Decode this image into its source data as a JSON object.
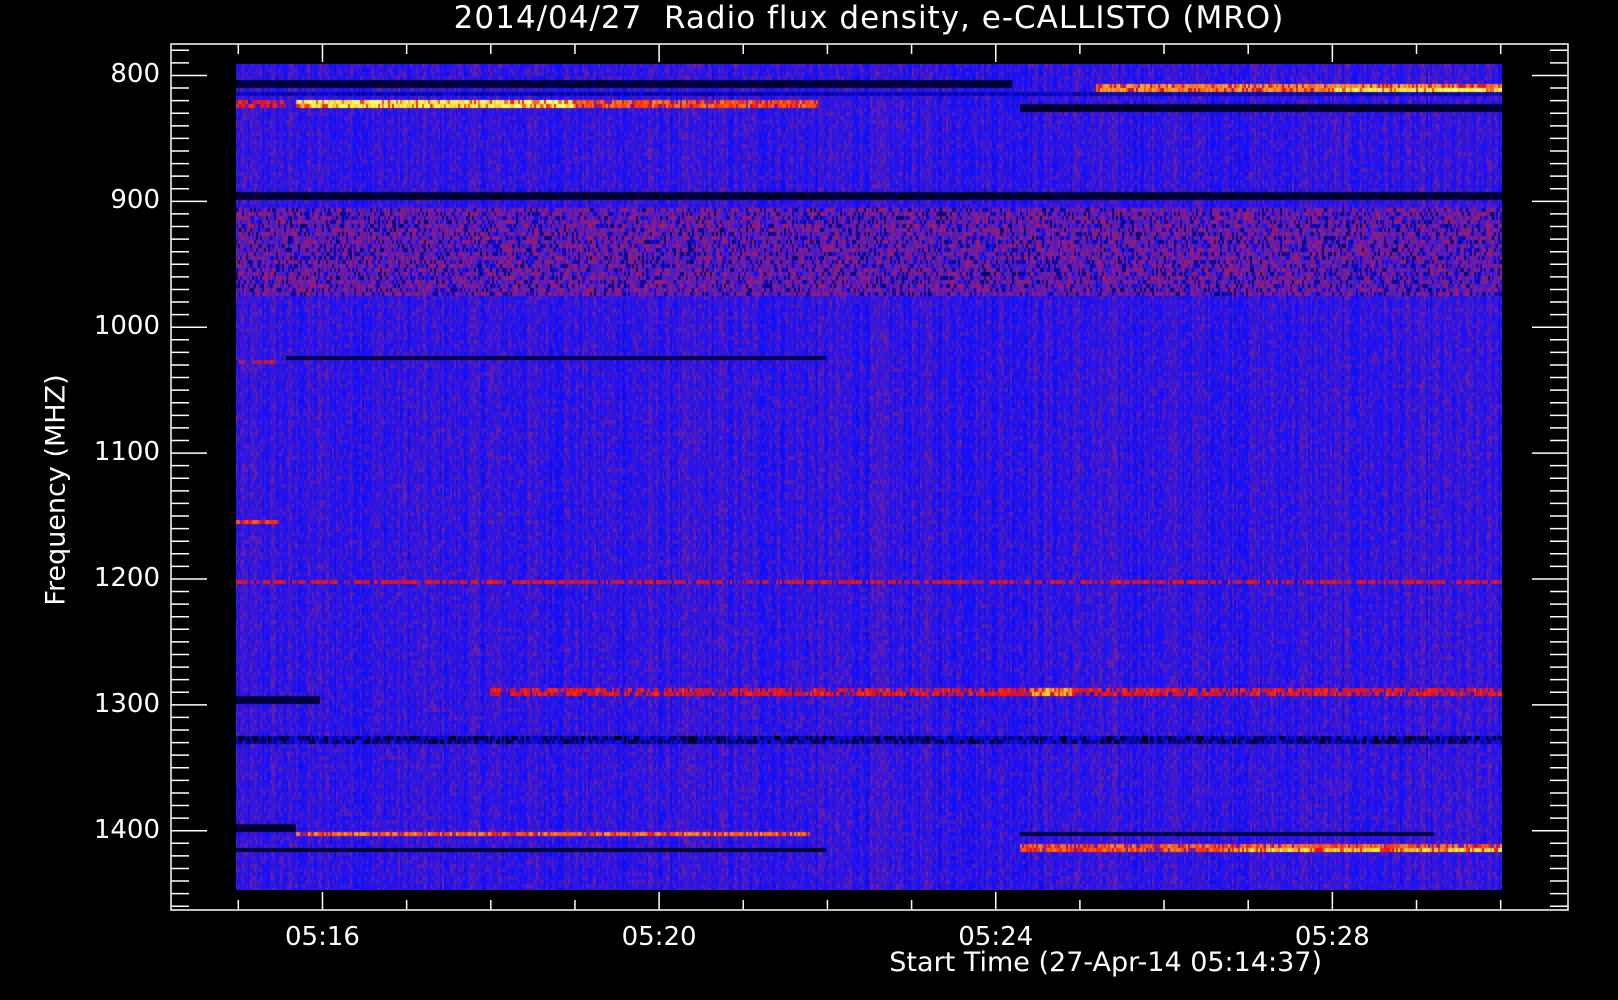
{
  "chart_data": {
    "type": "heatmap",
    "title": "2014/04/27  Radio flux density, e-CALLISTO (MRO)",
    "xlabel": "Start Time (27-Apr-14 05:14:37)",
    "ylabel": "Frequency (MHZ)",
    "x_unit": "minutes after 05:00 UT",
    "xlim": [
      14.2,
      30.8
    ],
    "data_x_range": [
      15.0,
      30.0
    ],
    "x_ticks": [
      {
        "value": 16,
        "label": "05:16"
      },
      {
        "value": 20,
        "label": "05:20"
      },
      {
        "value": 24,
        "label": "05:24"
      },
      {
        "value": 28,
        "label": "05:28"
      }
    ],
    "x_minor_step": 1,
    "ylim": [
      1463,
      775
    ],
    "data_y_range": [
      791,
      1447
    ],
    "y_ticks": [
      {
        "value": 800,
        "label": "800"
      },
      {
        "value": 900,
        "label": "900"
      },
      {
        "value": 1000,
        "label": "1000"
      },
      {
        "value": 1100,
        "label": "1100"
      },
      {
        "value": 1200,
        "label": "1200"
      },
      {
        "value": 1300,
        "label": "1300"
      },
      {
        "value": 1400,
        "label": "1400"
      }
    ],
    "y_minor_step": 10,
    "colormap": [
      "#000000",
      "#000060",
      "#1010ff",
      "#7020a0",
      "#ff1000",
      "#ff8020",
      "#ffff40",
      "#ffffff"
    ],
    "background_level": 0.32,
    "features": [
      {
        "freq": [
          805,
          811
        ],
        "time": [
          15.0,
          24.2
        ],
        "level": 0.05
      },
      {
        "freq": [
          806,
          812
        ],
        "time": [
          25.2,
          30.0
        ],
        "level": 0.72
      },
      {
        "freq": [
          809,
          812
        ],
        "time": [
          28.0,
          30.0
        ],
        "level": 0.86
      },
      {
        "freq": [
          813,
          817
        ],
        "time": [
          15.0,
          30.0
        ],
        "level": 0.18
      },
      {
        "freq": [
          819,
          826
        ],
        "time": [
          15.7,
          19.0
        ],
        "level": 0.85
      },
      {
        "freq": [
          819,
          826
        ],
        "time": [
          19.0,
          21.9
        ],
        "level": 0.66
      },
      {
        "freq": [
          819,
          826
        ],
        "time": [
          15.0,
          15.6
        ],
        "level": 0.55
      },
      {
        "freq": [
          823,
          828
        ],
        "time": [
          24.3,
          30.0
        ],
        "level": 0.03
      },
      {
        "freq": [
          891,
          898
        ],
        "time": [
          15.0,
          30.0
        ],
        "level": 0.04
      },
      {
        "freq": [
          905,
          975
        ],
        "time": [
          15.0,
          30.0
        ],
        "level": 0.42
      },
      {
        "freq": [
          1021,
          1024
        ],
        "time": [
          15.6,
          22.0
        ],
        "level": 0.06
      },
      {
        "freq": [
          1024,
          1029
        ],
        "time": [
          15.0,
          15.5
        ],
        "level": 0.5
      },
      {
        "freq": [
          1153,
          1157
        ],
        "time": [
          15.0,
          15.5
        ],
        "level": 0.62
      },
      {
        "freq": [
          1200,
          1204
        ],
        "time": [
          15.0,
          30.0
        ],
        "level": 0.52
      },
      {
        "freq": [
          1285,
          1291
        ],
        "time": [
          18.0,
          30.0
        ],
        "level": 0.55
      },
      {
        "freq": [
          1285,
          1291
        ],
        "time": [
          24.4,
          24.9
        ],
        "level": 0.75
      },
      {
        "freq": [
          1292,
          1297
        ],
        "time": [
          15.0,
          16.0
        ],
        "level": 0.05
      },
      {
        "freq": [
          1324,
          1330
        ],
        "time": [
          15.0,
          30.0
        ],
        "level": 0.22
      },
      {
        "freq": [
          1394,
          1399
        ],
        "time": [
          15.0,
          15.7
        ],
        "level": 0.03
      },
      {
        "freq": [
          1398,
          1403
        ],
        "time": [
          15.7,
          21.8
        ],
        "level": 0.68
      },
      {
        "freq": [
          1398,
          1403
        ],
        "time": [
          24.3,
          29.2
        ],
        "level": 0.06
      },
      {
        "freq": [
          1411,
          1415
        ],
        "time": [
          15.0,
          22.0
        ],
        "level": 0.04
      },
      {
        "freq": [
          1410,
          1416
        ],
        "time": [
          24.3,
          30.0
        ],
        "level": 0.66
      },
      {
        "freq": [
          1411,
          1415
        ],
        "time": [
          26.8,
          30.0
        ],
        "level": 0.8
      }
    ]
  }
}
